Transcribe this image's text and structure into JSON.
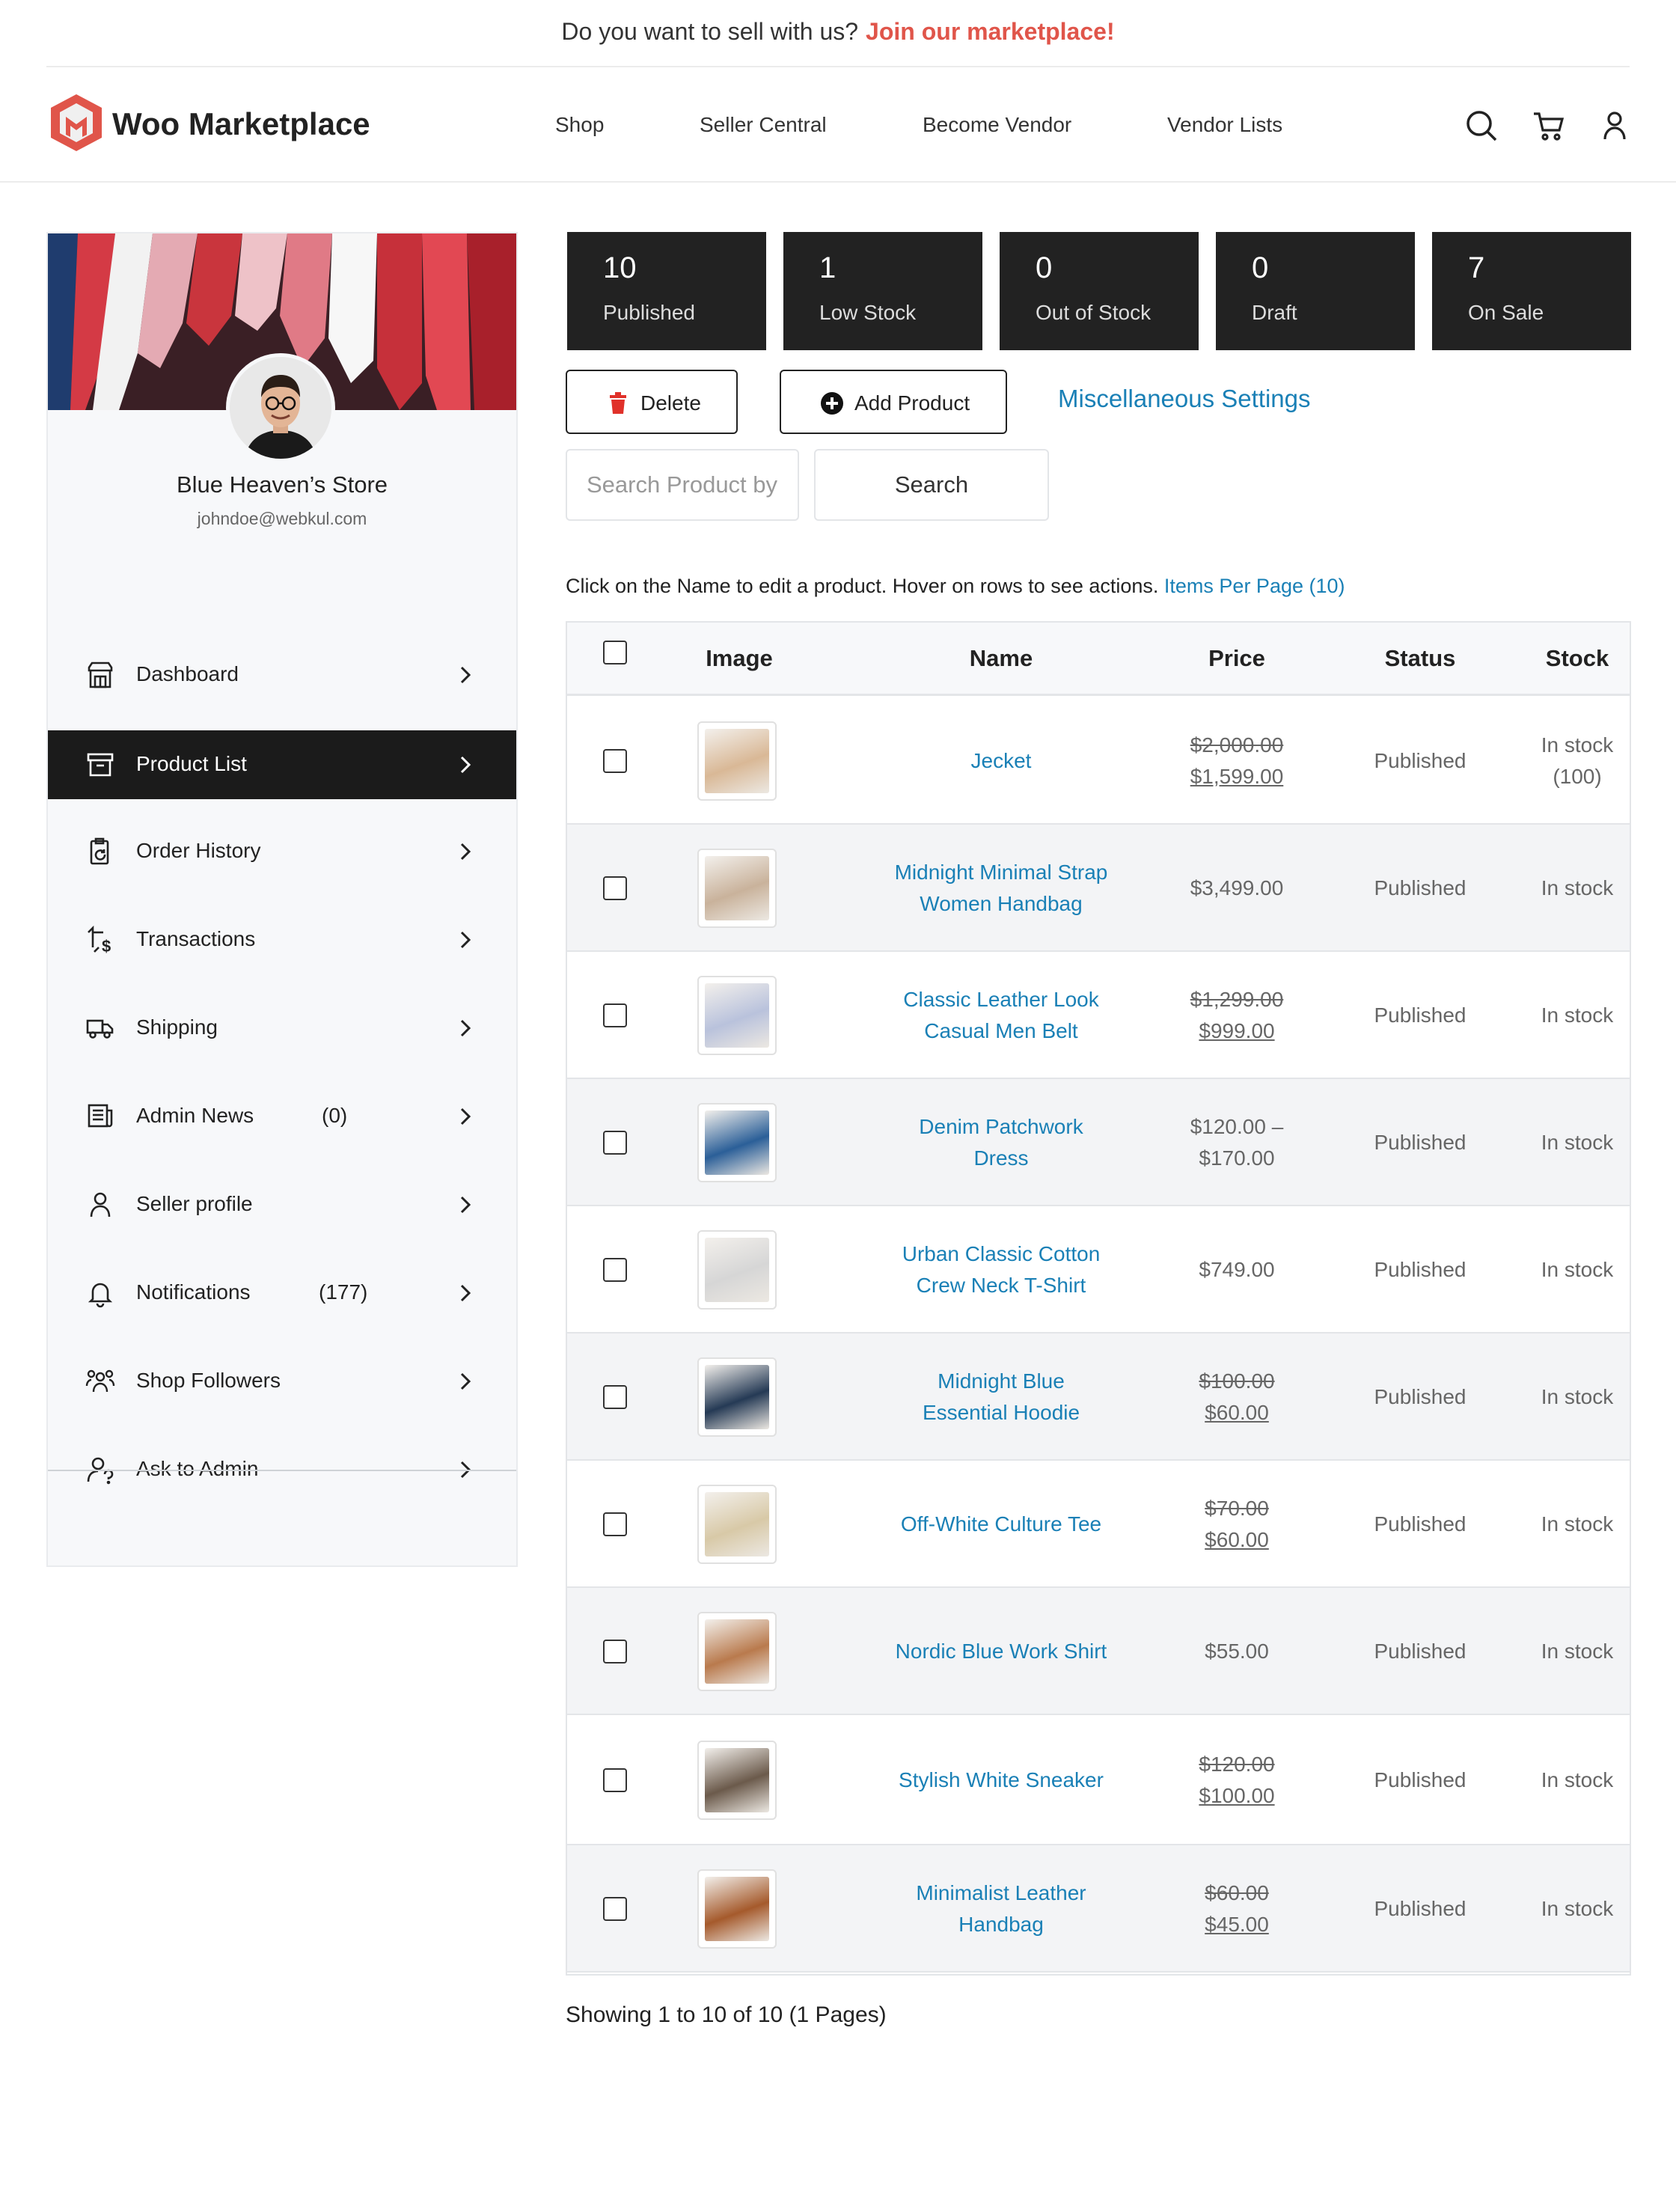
{
  "topbar": {
    "text": "Do you want to sell with us?",
    "link": "Join our marketplace!"
  },
  "header": {
    "logo_text": "Woo Marketplace",
    "nav": [
      "Shop",
      "Seller Central",
      "Become Vendor",
      "Vendor Lists"
    ],
    "icons": [
      "search-icon",
      "cart-icon",
      "user-icon"
    ],
    "accent_color": "#e0554a"
  },
  "store": {
    "name": "Blue Heaven’s Store",
    "email": "johndoe@webkul.com"
  },
  "sidebar": {
    "items": [
      {
        "label": "Dashboard",
        "icon": "store-icon",
        "count": ""
      },
      {
        "label": "Product List",
        "icon": "archive-icon",
        "count": ""
      },
      {
        "label": "Order History",
        "icon": "clipboard-icon",
        "count": ""
      },
      {
        "label": "Transactions",
        "icon": "transfer-dollar-icon",
        "count": ""
      },
      {
        "label": "Shipping",
        "icon": "truck-icon",
        "count": ""
      },
      {
        "label": "Admin News",
        "icon": "news-icon",
        "count": "(0)"
      },
      {
        "label": "Seller profile",
        "icon": "person-icon",
        "count": ""
      },
      {
        "label": "Notifications",
        "icon": "bell-icon",
        "count": "(177)"
      },
      {
        "label": "Shop Followers",
        "icon": "group-icon",
        "count": ""
      },
      {
        "label": "Ask to Admin",
        "icon": "person-question-icon",
        "count": ""
      }
    ],
    "active": "Product List"
  },
  "stats": [
    {
      "value": "10",
      "label": "Published"
    },
    {
      "value": "1",
      "label": "Low Stock"
    },
    {
      "value": "0",
      "label": "Out of Stock"
    },
    {
      "value": "0",
      "label": "Draft"
    },
    {
      "value": "7",
      "label": "On Sale"
    }
  ],
  "actions": {
    "delete_label": "Delete",
    "add_label": "Add Product",
    "misc_link": "Miscellaneous Settings",
    "search_placeholder": "Search Product by",
    "search_button": "Search"
  },
  "hint": {
    "text": "Click on the Name to edit a product. Hover on rows to see actions.",
    "link": "Items Per Page (10)"
  },
  "table": {
    "columns": [
      "Image",
      "Name",
      "Price",
      "Status",
      "Stock"
    ],
    "rows": [
      {
        "name": [
          "Jecket"
        ],
        "price_old": "$2,000.00",
        "price_new": "$1,599.00",
        "status": "Published",
        "stock": [
          "In stock",
          "(100)"
        ],
        "thumb_color": "#d9b896"
      },
      {
        "name": [
          "Midnight Minimal Strap",
          "Women Handbag"
        ],
        "price": [
          "$3,499.00"
        ],
        "status": "Published",
        "stock": [
          "In stock"
        ],
        "thumb_color": "#c9b29b"
      },
      {
        "name": [
          "Classic Leather Look",
          "Casual Men Belt"
        ],
        "price_old": "$1,299.00",
        "price_new": "$999.00",
        "status": "Published",
        "stock": [
          "In stock"
        ],
        "thumb_color": "#b9c2dc"
      },
      {
        "name": [
          "Denim Patchwork",
          "Dress"
        ],
        "price": [
          "$120.00 –",
          "$170.00"
        ],
        "status": "Published",
        "stock": [
          "In stock"
        ],
        "thumb_color": "#2b5f98"
      },
      {
        "name": [
          "Urban Classic Cotton",
          "Crew Neck T-Shirt"
        ],
        "price": [
          "$749.00"
        ],
        "status": "Published",
        "stock": [
          "In stock"
        ],
        "thumb_color": "#d6d6d6"
      },
      {
        "name": [
          "Midnight Blue",
          "Essential Hoodie"
        ],
        "price_old": "$100.00",
        "price_new": "$60.00",
        "status": "Published",
        "stock": [
          "In stock"
        ],
        "thumb_color": "#253a55"
      },
      {
        "name": [
          "Off-White Culture Tee"
        ],
        "price_old": "$70.00",
        "price_new": "$60.00",
        "status": "Published",
        "stock": [
          "In stock"
        ],
        "thumb_color": "#d8c9a7"
      },
      {
        "name": [
          "Nordic Blue Work Shirt"
        ],
        "price": [
          "$55.00"
        ],
        "status": "Published",
        "stock": [
          "In stock"
        ],
        "thumb_color": "#b97a4d"
      },
      {
        "name": [
          "Stylish White Sneaker"
        ],
        "price_old": "$120.00",
        "price_new": "$100.00",
        "status": "Published",
        "stock": [
          "In stock"
        ],
        "thumb_color": "#6b5a4b"
      },
      {
        "name": [
          "Minimalist Leather",
          "Handbag"
        ],
        "price_old": "$60.00",
        "price_new": "$45.00",
        "status": "Published",
        "stock": [
          "In stock"
        ],
        "thumb_color": "#a55a2c"
      }
    ]
  },
  "pagination": {
    "showing": "Showing 1 to 10 of 10 (1 Pages)"
  }
}
